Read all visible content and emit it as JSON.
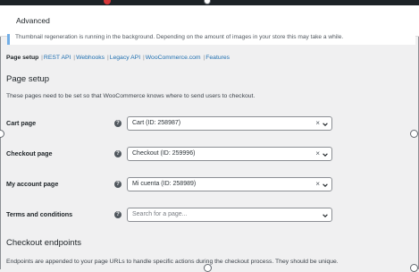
{
  "header": {
    "tab_label": "Advanced"
  },
  "notice": {
    "text": "Thumbnail regeneration is running in the background. Depending on the amount of images in your store this may take a while."
  },
  "subnav": {
    "current": "Page setup",
    "links": [
      "REST API",
      "Webhooks",
      "Legacy API",
      "WooCommerce.com",
      "Features"
    ]
  },
  "page_setup": {
    "title": "Page setup",
    "description": "These pages need to be set so that WooCommerce knows where to send users to checkout.",
    "rows": [
      {
        "label": "Cart page",
        "value": "Cart (ID: 258987)",
        "clear": "×"
      },
      {
        "label": "Checkout page",
        "value": "Checkout (ID: 259996)",
        "clear": "×"
      },
      {
        "label": "My account page",
        "value": "Mi cuenta (ID: 258989)",
        "clear": "×"
      },
      {
        "label": "Terms and conditions",
        "placeholder": "Search for a page..."
      }
    ],
    "help_glyph": "?"
  },
  "checkout_endpoints": {
    "title": "Checkout endpoints",
    "description": "Endpoints are appended to your page URLs to handle specific actions during the checkout process. They should be unique."
  },
  "colors": {
    "link": "#2271b1",
    "notice_border": "#72aee6",
    "topbar": "#1d2327"
  }
}
